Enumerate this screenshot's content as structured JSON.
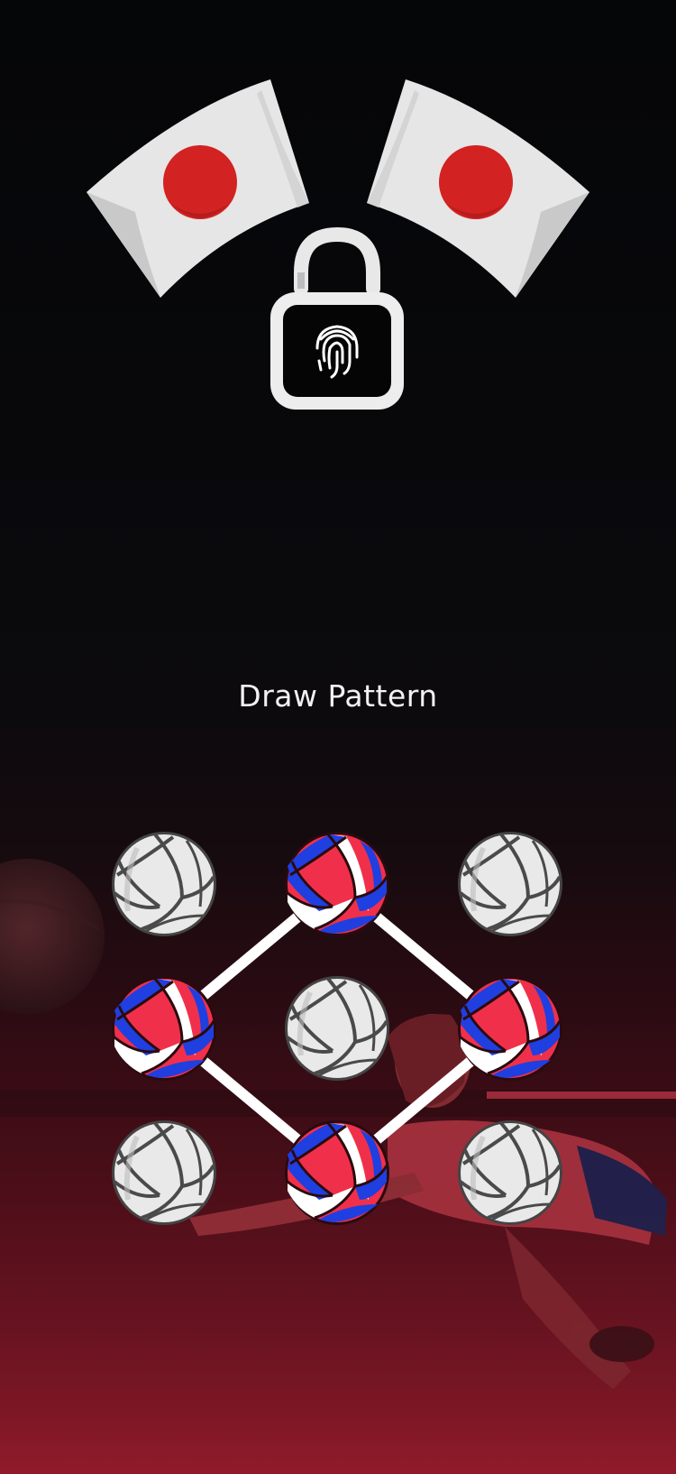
{
  "screen": {
    "title": "Draw Pattern"
  },
  "header": {
    "flags": [
      {
        "icon": "japan-flag-icon",
        "colors": {
          "field": "#e8e8e8",
          "disc": "#d32222"
        }
      },
      {
        "icon": "japan-flag-icon",
        "colors": {
          "field": "#e8e8e8",
          "disc": "#d32222"
        }
      }
    ],
    "lock_icon": "unlocked-padlock-fingerprint-icon"
  },
  "pattern": {
    "grid_size": 3,
    "dot_icon": "volleyball-icon",
    "selected_sequence": [
      1,
      3,
      7,
      5
    ],
    "selected_colors": {
      "red": "#f0304a",
      "blue": "#1f3fe0",
      "white": "#ffffff"
    },
    "line_color": "#ffffff"
  },
  "background": {
    "description_colors": {
      "top": "#050608",
      "bottom": "#7a1524"
    }
  }
}
